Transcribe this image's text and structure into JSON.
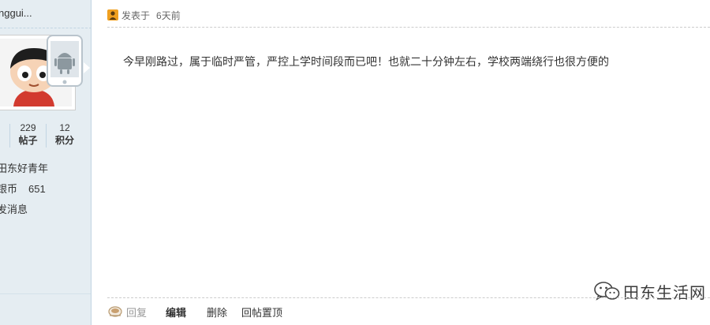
{
  "sidebar": {
    "username": "nggui...",
    "stats": [
      {
        "value": "",
        "label": ""
      },
      {
        "value": "229",
        "label": "帖子"
      },
      {
        "value": "12",
        "label": "积分"
      }
    ],
    "group": "田东好青年",
    "coins_label": "银币",
    "coins_value": "651",
    "send_message": "发消息"
  },
  "post": {
    "meta_prefix": "发表于",
    "meta_time": "6天前",
    "body": "今早刚路过，属于临时严管，严控上学时间段而已吧！也就二十分钟左右，学校两端绕行也很方便的"
  },
  "actions": {
    "reply": "回复",
    "edit": "编辑",
    "delete": "删除",
    "pin_reply": "回帖置顶"
  },
  "watermark": {
    "text": "田东生活网"
  }
}
